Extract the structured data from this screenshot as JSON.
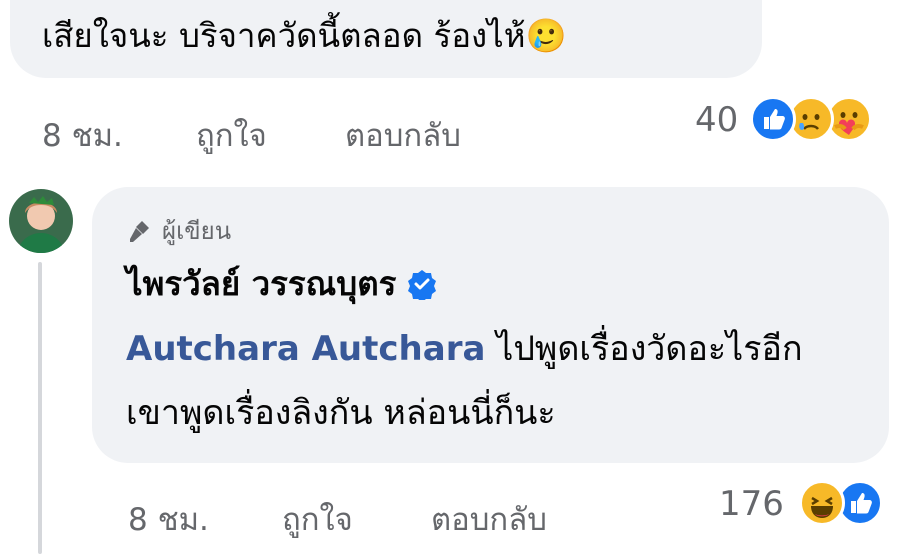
{
  "top_comment": {
    "text": "เสียใจนะ บริจาควัดนี้ตลอด ร้องไห้🥲",
    "time": "8 ชม.",
    "like_label": "ถูกใจ",
    "reply_label": "ตอบกลับ",
    "reaction_count": "40",
    "reactions": [
      "like-icon",
      "sad-icon",
      "care-icon"
    ]
  },
  "reply": {
    "author_badge": "ผู้เขียน",
    "author_name": "ไพรวัลย์ วรรณบุตร",
    "mention": "Autchara Autchara",
    "text": " ไปพูดเรื่องวัดอะไรอีก เขาพูดเรื่องลิงกัน หล่อนนี่ก็นะ",
    "time": "8 ชม.",
    "like_label": "ถูกใจ",
    "reply_label": "ตอบกลับ",
    "reaction_count": "176",
    "reactions": [
      "haha-icon",
      "like-icon"
    ]
  },
  "colors": {
    "bubble": "#f0f2f5",
    "meta_text": "#65676b",
    "mention": "#385898",
    "like_blue": "#1877f2",
    "reaction_yellow": "#f7b928"
  }
}
